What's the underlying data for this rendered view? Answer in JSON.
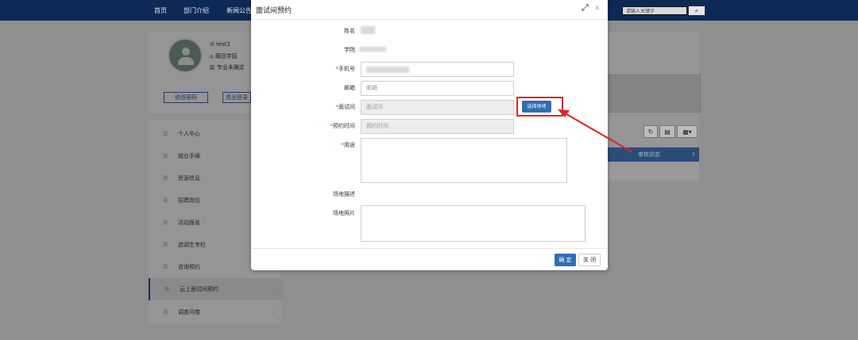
{
  "nav": [
    "首页",
    "部门介绍",
    "新闻公告"
  ],
  "search": {
    "placeholder": "请输入关键字"
  },
  "profile": {
    "username": "test2",
    "school": "莆田学园",
    "major": "专业未确定",
    "change_password": "修改密码",
    "logout": "退出登录"
  },
  "menu": [
    {
      "label": "个人中心"
    },
    {
      "label": "就业手续"
    },
    {
      "label": "资源信息"
    },
    {
      "label": "招聘岗位"
    },
    {
      "label": "活动报名"
    },
    {
      "label": "选调生专栏"
    },
    {
      "label": "咨询预约"
    },
    {
      "label": "云上面试间预约",
      "active": true
    },
    {
      "label": "调查问卷"
    }
  ],
  "table": {
    "status_header": "审核状态"
  },
  "modal": {
    "title": "面试间预约",
    "fields": {
      "name": "姓名",
      "college": "学院",
      "phone": "手机号",
      "email": "邮箱",
      "room": "面试间",
      "time": "预约时间",
      "purpose": "用途",
      "venue_desc": "场地描述",
      "venue_photo": "场地照片"
    },
    "placeholders": {
      "email": "邮箱",
      "room": "面试间",
      "time": "预约时间"
    },
    "pick_venue": "选择场地",
    "confirm": "确 定",
    "close": "关 闭"
  },
  "colors": {
    "primary": "#2e6fb4",
    "highlight": "#e02424",
    "header": "#0c2a55"
  }
}
